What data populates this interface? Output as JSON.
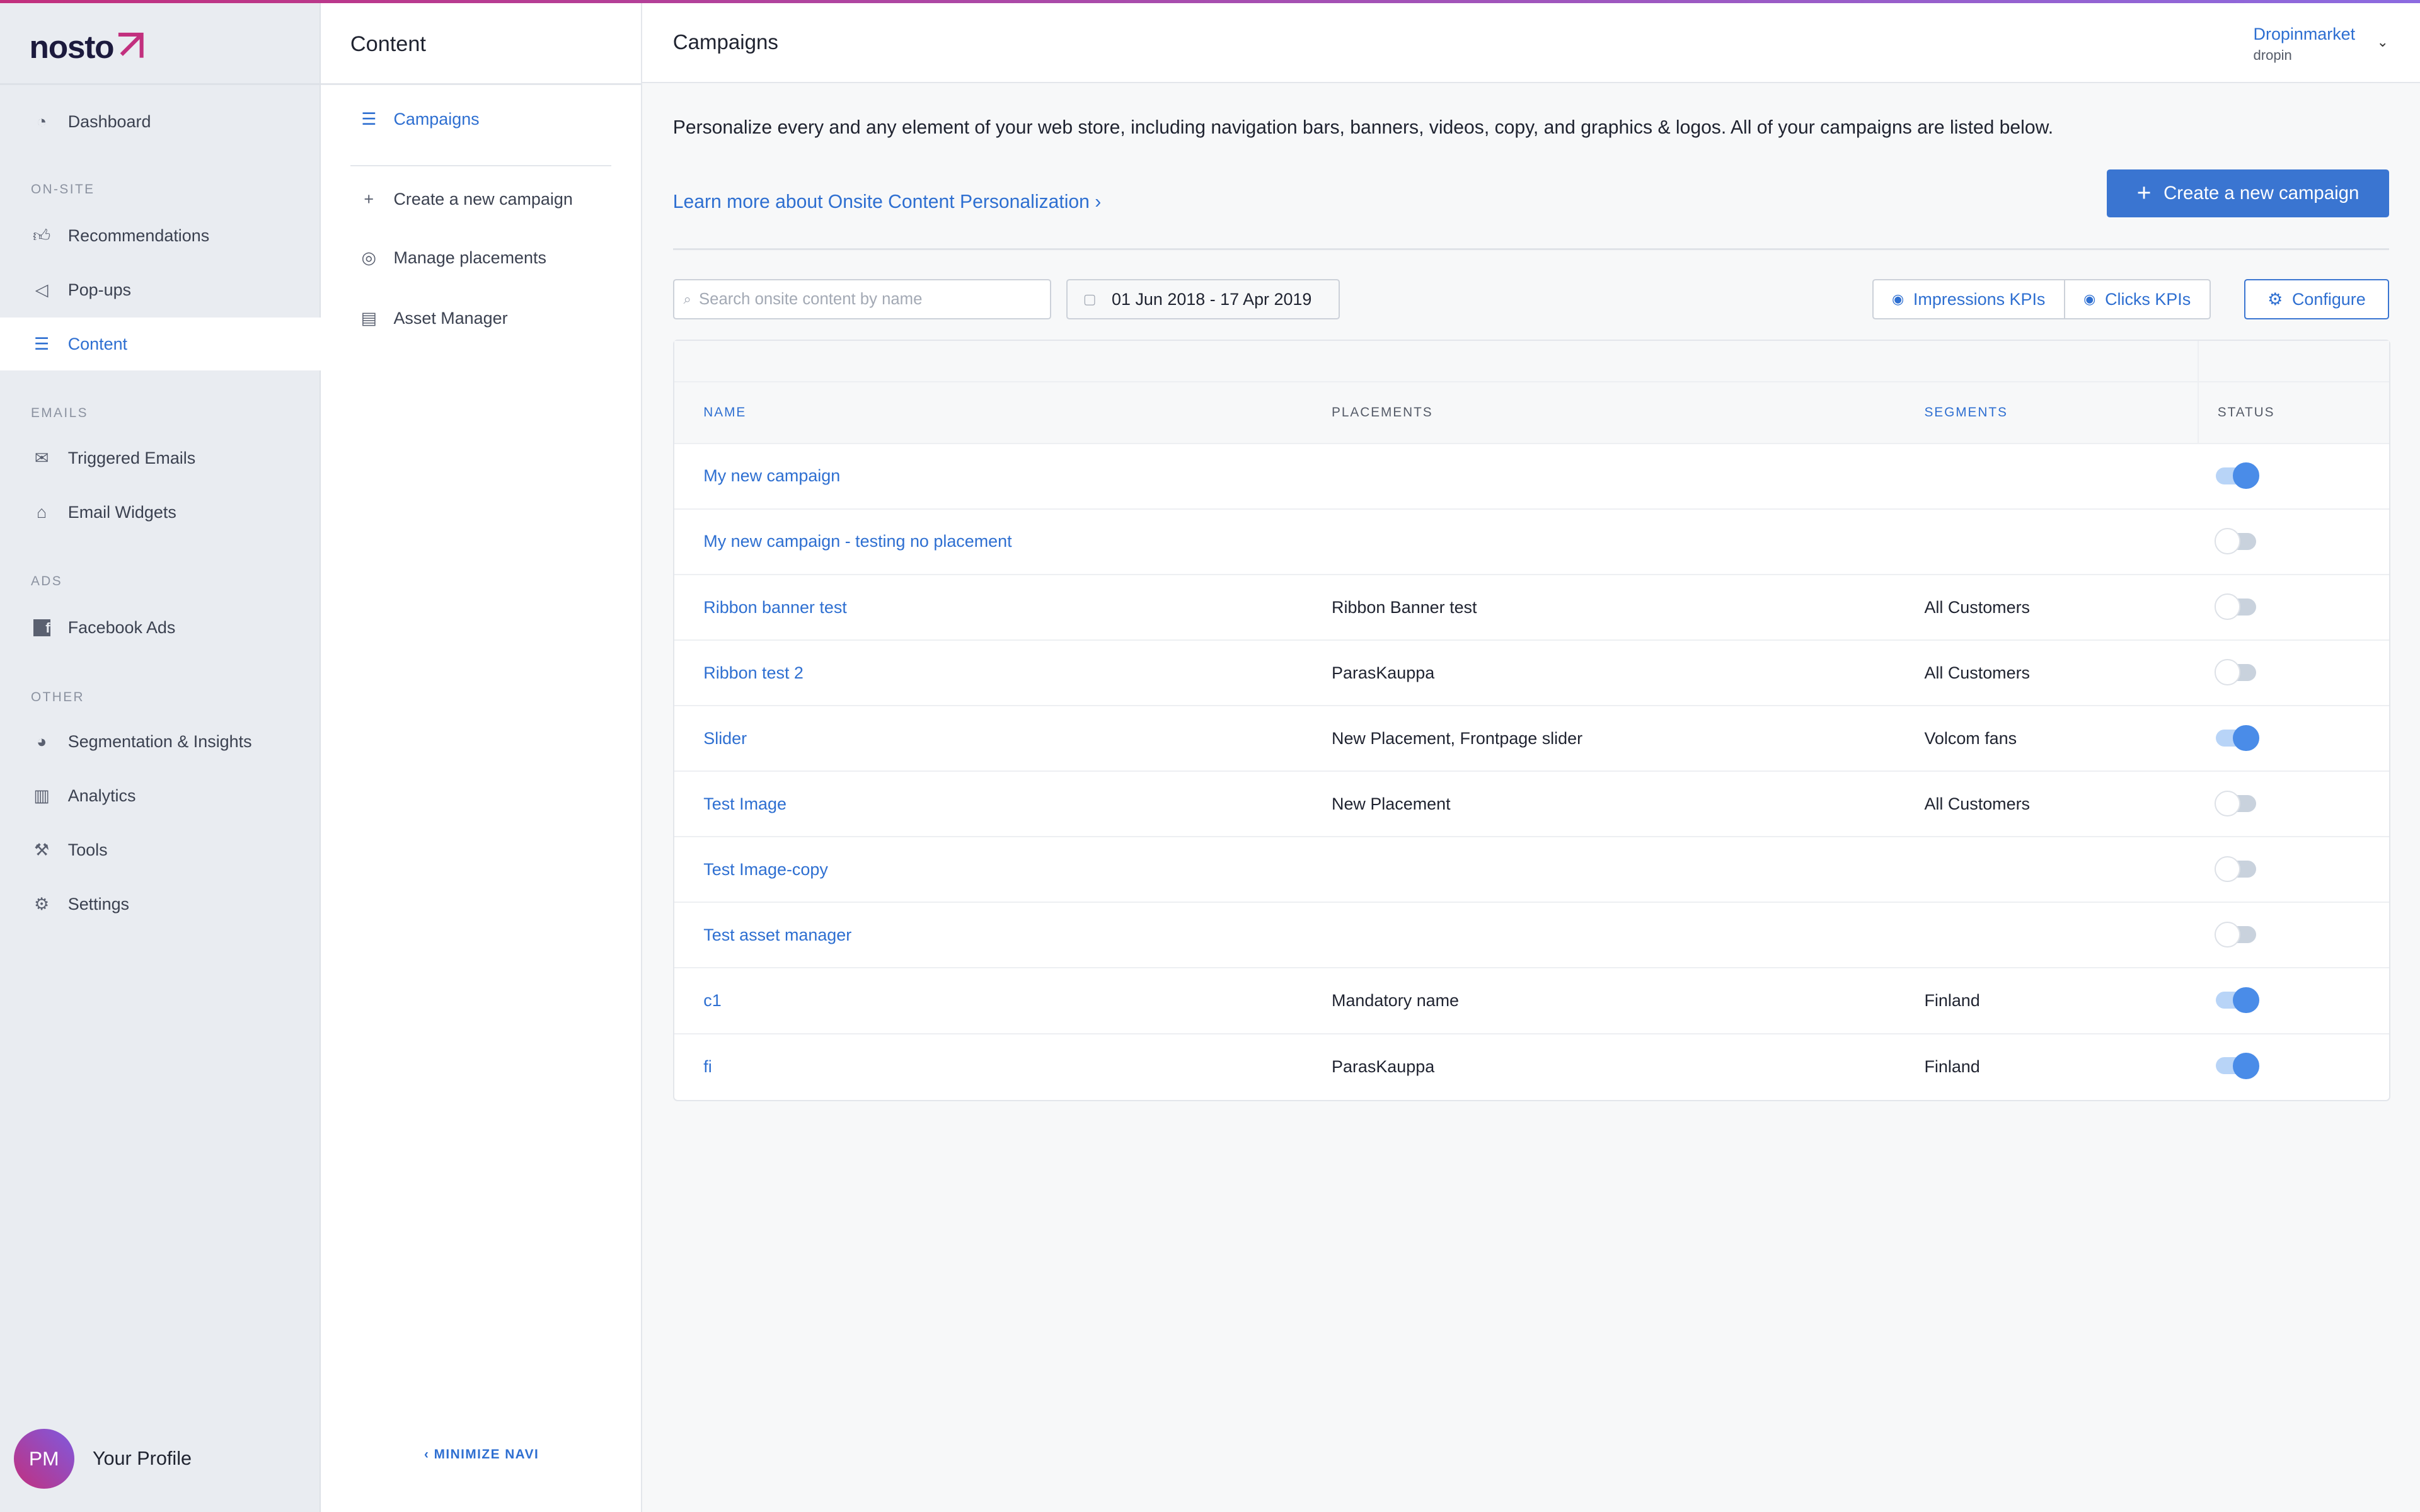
{
  "brand": {
    "logo": "nosto",
    "accent": "#2e6fd1",
    "primary_button": "#3a75d1"
  },
  "sidebar": {
    "dashboard": "Dashboard",
    "sections": {
      "onsite": "ON-SITE",
      "emails": "EMAILS",
      "ads": "ADS",
      "other": "OTHER"
    },
    "items": [
      {
        "label": "Recommendations",
        "icon": "thumbs-up-icon"
      },
      {
        "label": "Pop-ups",
        "icon": "megaphone-icon"
      },
      {
        "label": "Content",
        "icon": "content-icon",
        "active": true
      },
      {
        "label": "Triggered Emails",
        "icon": "envelope-icon"
      },
      {
        "label": "Email Widgets",
        "icon": "inbox-icon"
      },
      {
        "label": "Facebook Ads",
        "icon": "facebook-icon"
      },
      {
        "label": "Segmentation & Insights",
        "icon": "pie-chart-icon"
      },
      {
        "label": "Analytics",
        "icon": "bar-chart-icon"
      },
      {
        "label": "Tools",
        "icon": "wrench-icon"
      },
      {
        "label": "Settings",
        "icon": "gear-icon"
      }
    ],
    "profile": {
      "initials": "PM",
      "label": "Your Profile"
    }
  },
  "subnav": {
    "title": "Content",
    "items": [
      {
        "label": "Campaigns",
        "icon": "list-icon",
        "active": true
      },
      {
        "label": "Create a new campaign",
        "icon": "plus-icon"
      },
      {
        "label": "Manage placements",
        "icon": "target-icon"
      },
      {
        "label": "Asset Manager",
        "icon": "image-file-icon"
      }
    ],
    "minimize": "MINIMIZE NAVI"
  },
  "header": {
    "title": "Campaigns",
    "account": "Dropinmarket",
    "account_sub": "dropin"
  },
  "main": {
    "intro": "Personalize every and any element of your web store, including navigation bars, banners, videos, copy, and graphics & logos. All of your campaigns are listed below.",
    "learn_more": "Learn more about Onsite Content Personalization",
    "create_button": "Create a new campaign",
    "search_placeholder": "Search onsite content by name",
    "date_range": "01 Jun 2018 - 17 Apr 2019",
    "impressions_kpis": "Impressions KPIs",
    "clicks_kpis": "Clicks KPIs",
    "configure": "Configure"
  },
  "table": {
    "columns": [
      "NAME",
      "PLACEMENTS",
      "SEGMENTS",
      "STATUS"
    ],
    "rows": [
      {
        "name": "My new campaign",
        "placements": "",
        "segments": "",
        "enabled": true
      },
      {
        "name": "My new campaign - testing no placement",
        "placements": "",
        "segments": "",
        "enabled": false
      },
      {
        "name": "Ribbon banner test",
        "placements": "Ribbon Banner test",
        "segments": "All Customers",
        "enabled": false
      },
      {
        "name": "Ribbon test 2",
        "placements": "ParasKauppa",
        "segments": "All Customers",
        "enabled": false
      },
      {
        "name": "Slider",
        "placements": "New Placement, Frontpage slider",
        "segments": "Volcom fans",
        "enabled": true
      },
      {
        "name": "Test Image",
        "placements": "New Placement",
        "segments": "All Customers",
        "enabled": false
      },
      {
        "name": "Test Image-copy",
        "placements": "",
        "segments": "",
        "enabled": false
      },
      {
        "name": "Test asset manager",
        "placements": "",
        "segments": "",
        "enabled": false
      },
      {
        "name": "c1",
        "placements": "Mandatory name",
        "segments": "Finland",
        "enabled": true
      },
      {
        "name": "fi",
        "placements": "ParasKauppa",
        "segments": "Finland",
        "enabled": true
      }
    ]
  }
}
